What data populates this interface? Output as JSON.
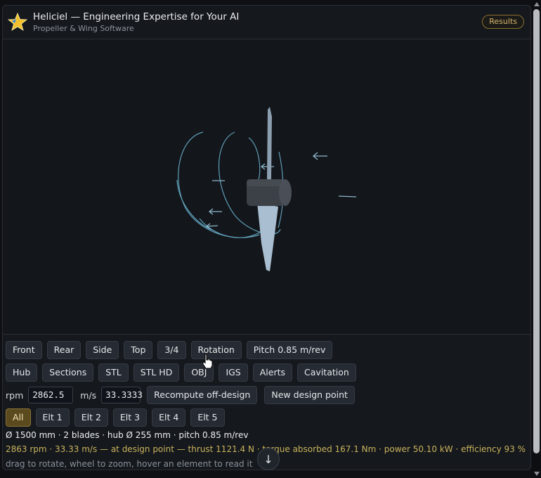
{
  "header": {
    "title": "Heliciel — Engineering Expertise for Your AI",
    "subtitle": "Propeller & Wing Software",
    "results_label": "Results"
  },
  "viewport": {
    "object": "propeller-3d-model",
    "colors": {
      "hub": "#3f444b",
      "blade": "#9fb4c6",
      "streamline": "#6fa7bf",
      "background": "#13161b"
    }
  },
  "view_buttons": [
    "Front",
    "Rear",
    "Side",
    "Top",
    "3/4",
    "Rotation",
    "Pitch 0.85 m/rev"
  ],
  "export_buttons": [
    "Hub",
    "Sections",
    "STL",
    "STL HD",
    "OBJ",
    "IGS",
    "Alerts",
    "Cavitation"
  ],
  "inputs": {
    "rpm_label": "rpm",
    "rpm_value": "2862.5",
    "ms_label": "m/s",
    "ms_value": "33.3333",
    "recompute_label": "Recompute off-design",
    "new_design_label": "New design point"
  },
  "element_buttons": [
    "All",
    "Elt 1",
    "Elt 2",
    "Elt 3",
    "Elt 4",
    "Elt 5"
  ],
  "info": {
    "geometry": "Ø 1500 mm · 2 blades · hub Ø 255 mm · pitch 0.85 m/rev",
    "operating": "2863 rpm · 33.33 m/s — at design point — thrust 1121.4 N · torque absorbed 167.1 Nm · power 50.10 kW · efficiency 93 %",
    "hint": "drag to rotate, wheel to zoom, hover an element to read it"
  }
}
